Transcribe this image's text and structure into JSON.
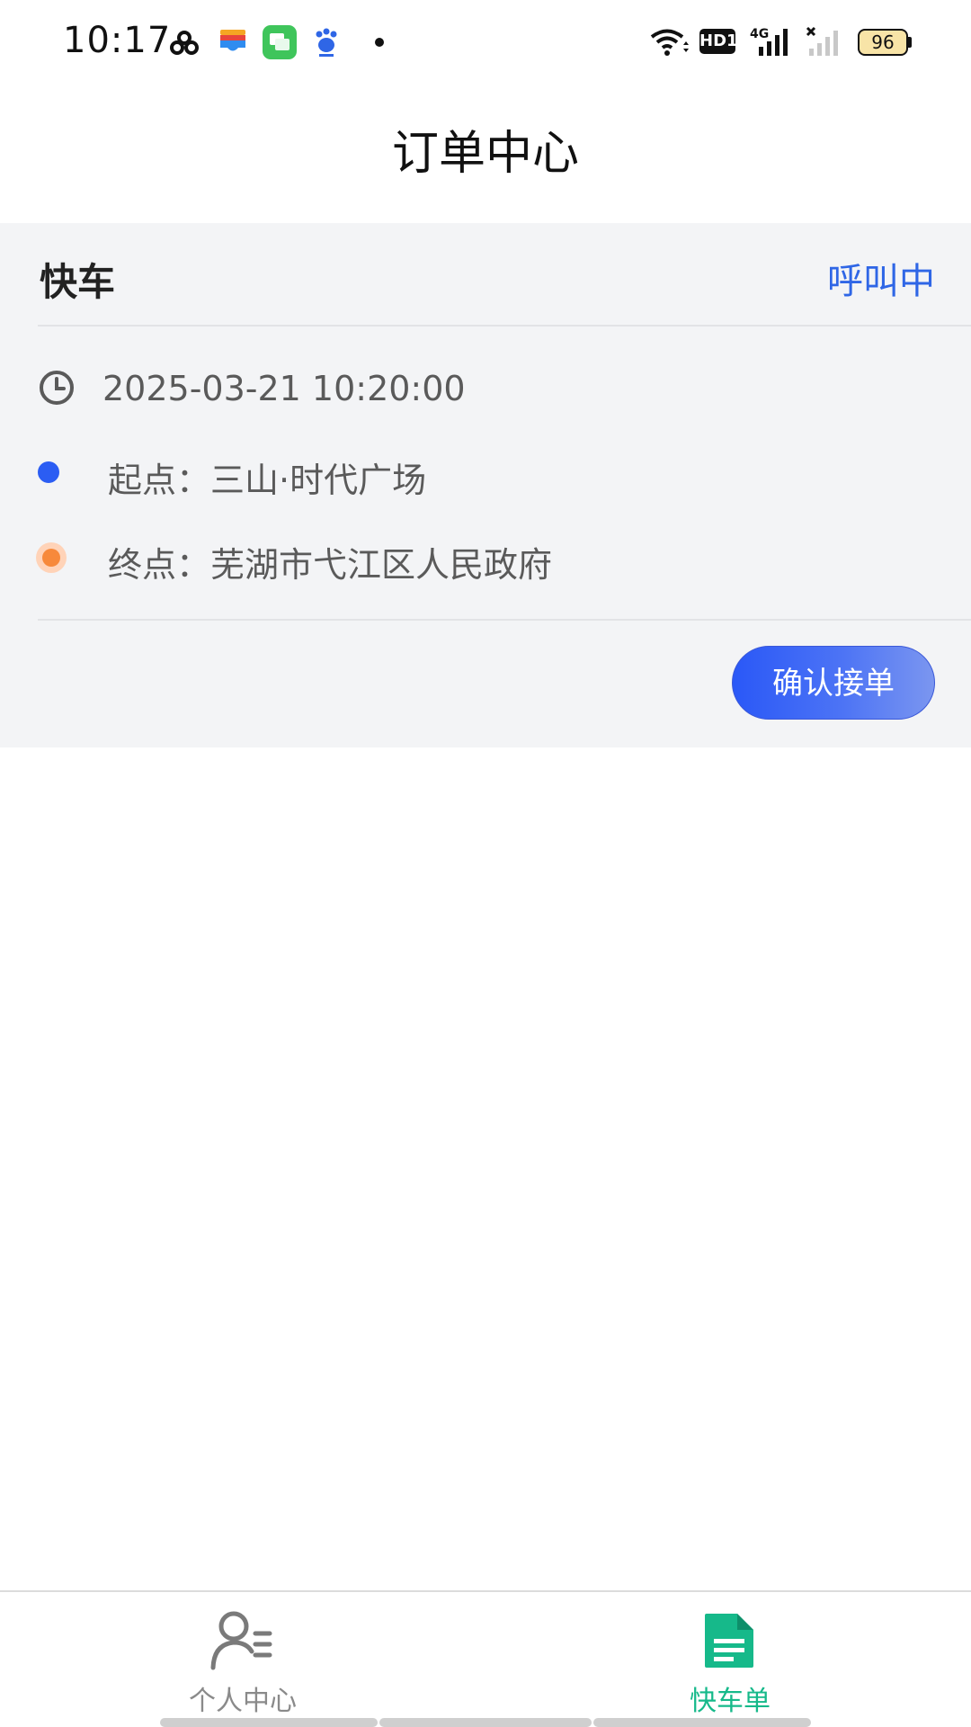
{
  "status_bar": {
    "time": "10:17",
    "battery": "96",
    "icons": [
      "app-cluster-icon",
      "wallet-app-icon",
      "messages-app-icon",
      "baidu-app-icon",
      "dot-icon",
      "wifi-icon",
      "hd-icon",
      "signal-4g-icon",
      "no-signal-icon",
      "battery-icon"
    ],
    "network": "4G",
    "hd_label": "HD1"
  },
  "header": {
    "title": "订单中心"
  },
  "order": {
    "type": "快车",
    "status": "呼叫中",
    "time": "2025-03-21 10:20:00",
    "start": "起点：三山·时代广场",
    "end": "终点：芜湖市弋江区人民政府",
    "accept_label": "确认接单"
  },
  "tabs": [
    {
      "label": "个人中心",
      "icon": "person-list-icon",
      "active": false
    },
    {
      "label": "快车单",
      "icon": "document-icon",
      "active": true
    }
  ],
  "colors": {
    "accent_blue": "#2f66e6",
    "active_tab": "#16b98a",
    "inactive_tab": "#8a8a8a",
    "card_bg": "#f3f4f6",
    "start_dot": "#2b5df3",
    "end_dot": "#f7893b"
  }
}
